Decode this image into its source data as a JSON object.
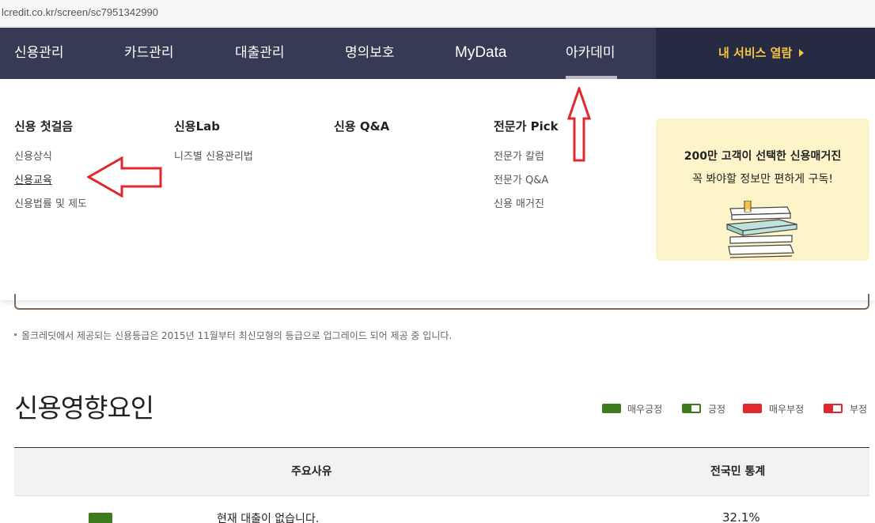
{
  "browser": {
    "url": "lcredit.co.kr/screen/sc7951342990"
  },
  "nav": {
    "items": [
      "신용관리",
      "카드관리",
      "대출관리",
      "명의보호",
      "MyData",
      "아카데미"
    ],
    "active": "아카데미",
    "cta_label": "내 서비스 열람"
  },
  "megamenu": {
    "columns": [
      {
        "title": "신용 첫걸음",
        "links": [
          "신용상식",
          "신용교육",
          "신용법률 및 제도"
        ]
      },
      {
        "title": "신용Lab",
        "links": [
          "니즈별 신용관리법"
        ]
      },
      {
        "title": "신용 Q&A",
        "links": []
      },
      {
        "title": "전문가 Pick",
        "links": [
          "전문가 칼럼",
          "전문가 Q&A",
          "신용 매거진"
        ]
      }
    ],
    "promo": {
      "title": "200만 고객이 선택한 신용매거진",
      "subtitle": "꼭 봐야할 정보만 편하게 구독!"
    }
  },
  "notice": "올크레딧에서 제공되는 신용등급은 2015년 11월부터 최신모형의 등급으로 업그레이드 되어 제공 중 입니다.",
  "section": {
    "title": "신용영향요인",
    "legend": [
      {
        "label": "매우긍정",
        "color": "#3e7b1f",
        "style": "full"
      },
      {
        "label": "긍정",
        "color": "#3e7b1f",
        "style": "half"
      },
      {
        "label": "매우부정",
        "color": "#e0282e",
        "style": "full"
      },
      {
        "label": "부정",
        "color": "#e0282e",
        "style": "half"
      }
    ]
  },
  "table": {
    "headers": {
      "reason": "주요사유",
      "stats": "전국민 통계"
    },
    "rows": [
      {
        "impact": "매우긍정",
        "reason": "현재 대출이 없습니다.",
        "stat": "32.1%"
      }
    ]
  },
  "colors": {
    "nav_bg": "#363a54",
    "cta_bg": "#262a42",
    "cta_text": "#f6c443",
    "promo_bg": "#fdf5c9",
    "annotation": "#e0282e"
  }
}
